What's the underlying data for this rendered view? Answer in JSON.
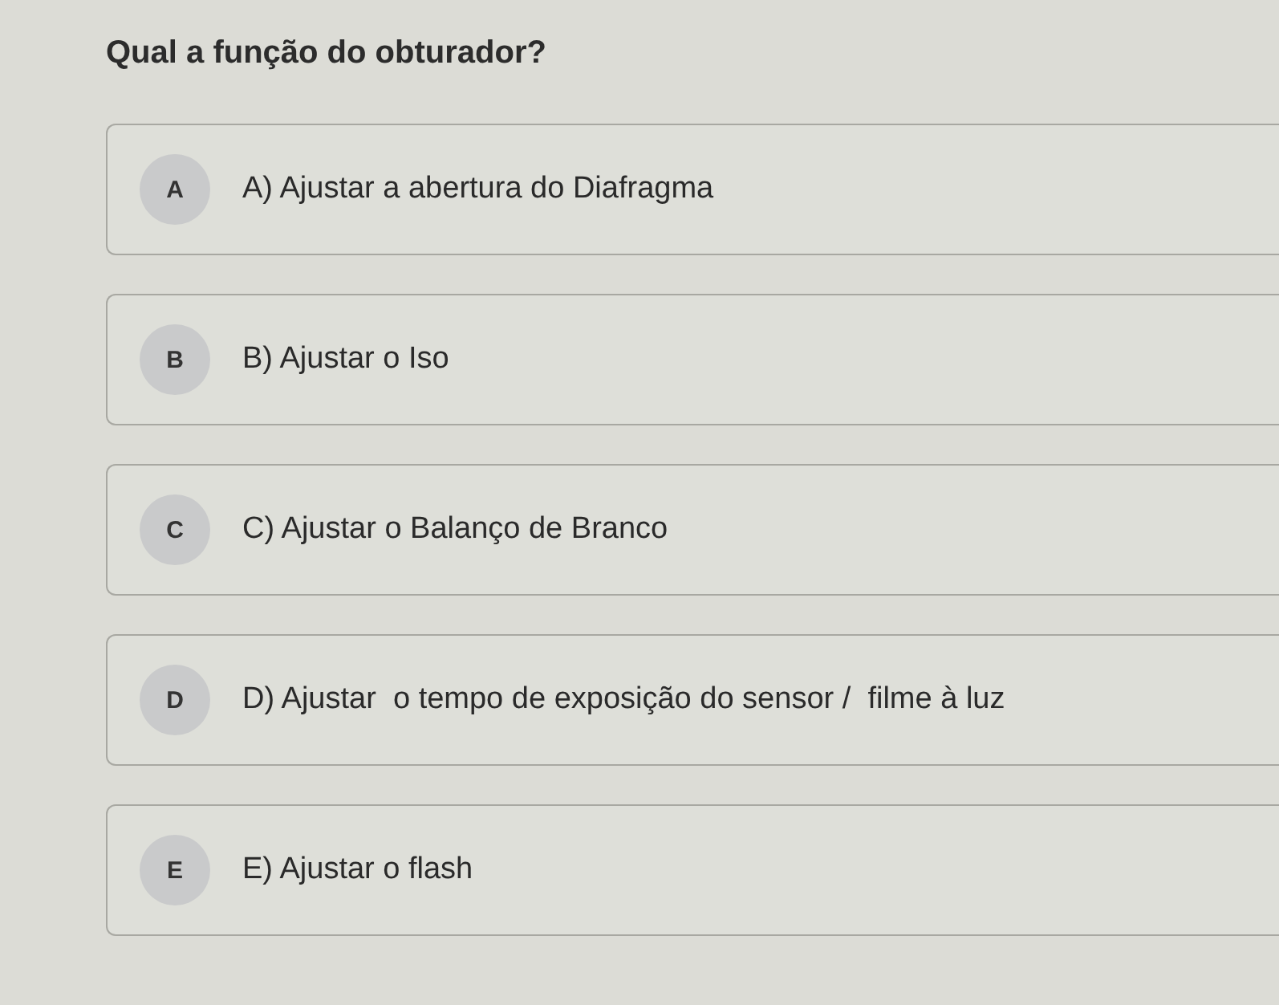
{
  "question": "Qual a função do obturador?",
  "options": [
    {
      "letter": "A",
      "text": "A) Ajustar a abertura do Diafragma",
      "selected": false
    },
    {
      "letter": "B",
      "text": "B) Ajustar o Iso",
      "selected": false
    },
    {
      "letter": "C",
      "text": "C) Ajustar o Balanço de Branco",
      "selected": false
    },
    {
      "letter": "D",
      "text": "D) Ajustar  o tempo de exposição do sensor /  filme à luz",
      "selected": false
    },
    {
      "letter": "E",
      "text": "E) Ajustar o flash",
      "selected": false
    }
  ]
}
